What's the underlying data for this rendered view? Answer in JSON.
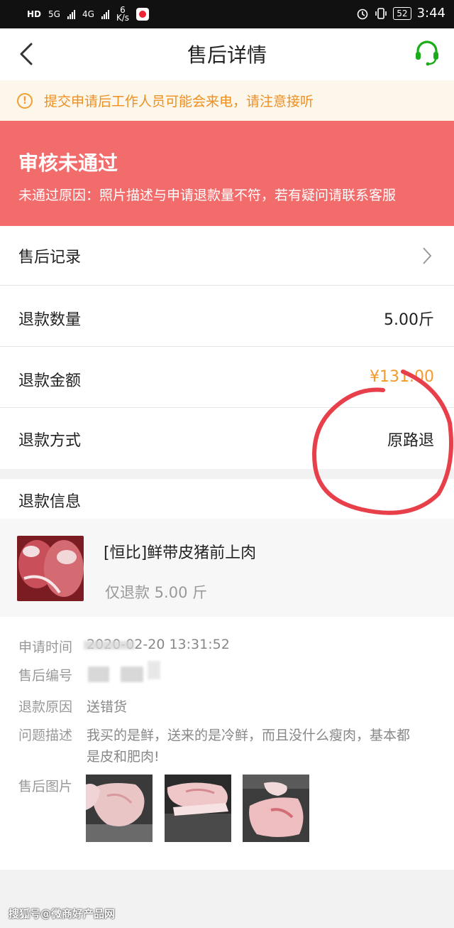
{
  "statusbar": {
    "hd": "HD",
    "net1": "5G",
    "net2": "4G",
    "speed_value": "6",
    "speed_unit": "K/s",
    "battery": "52",
    "time": "3:44"
  },
  "header": {
    "title": "售后详情"
  },
  "notice": {
    "icon": "!",
    "text": "提交申请后工作人员可能会来电，请注意接听"
  },
  "status": {
    "heading": "审核未通过",
    "reason": "未通过原因：照片描述与申请退款量不符，若有疑问请联系客服",
    "bg_color": "#f26c6c"
  },
  "rows": {
    "record_label": "售后记录",
    "qty_label": "退款数量",
    "qty_value": "5.00斤",
    "amount_label": "退款金额",
    "amount_value": "¥131.00",
    "amount_color": "#f39a2c",
    "method_label": "退款方式",
    "method_value": "原路退"
  },
  "refund_info": {
    "title": "退款信息"
  },
  "product": {
    "name": "[恒比]鲜带皮猪前上肉",
    "qty": "仅退款 5.00 斤"
  },
  "details": {
    "apply_time_label": "申请时间",
    "apply_time_value": "2020-02-20 13:31:52",
    "order_no_label": "售后编号",
    "reason_label": "退款原因",
    "reason_value": "送错货",
    "desc_label": "问题描述",
    "desc_line1": "我买的是鲜，送来的是冷鲜，而且没什么瘦肉，基本都",
    "desc_line2": "是皮和肥肉!",
    "photos_label": "售后图片"
  },
  "watermark": "搜狐号@微商好产品网"
}
